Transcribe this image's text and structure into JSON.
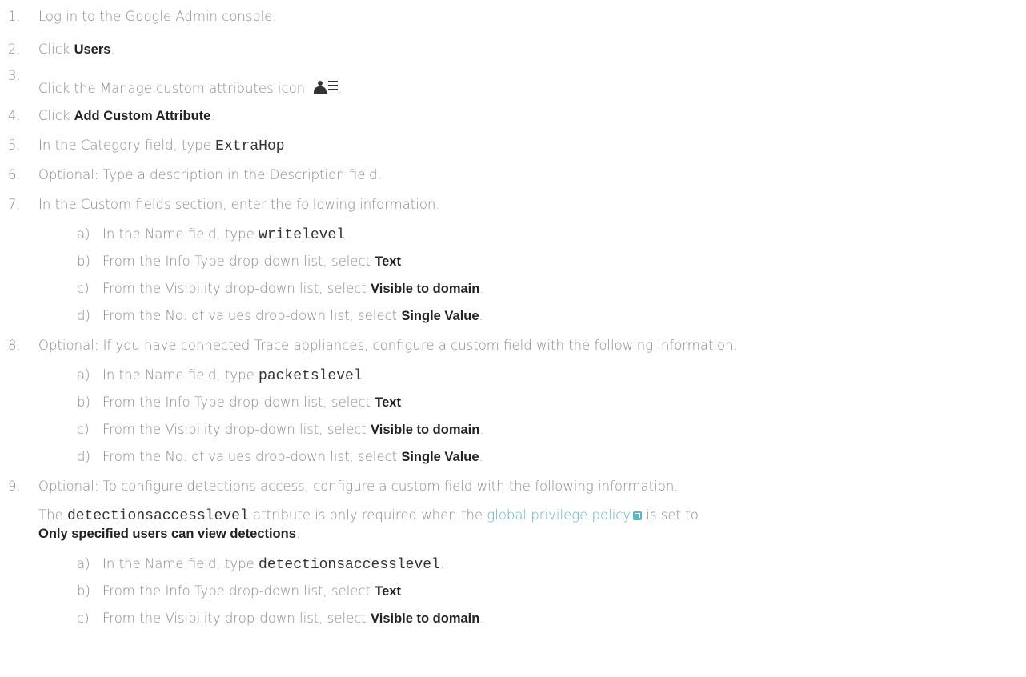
{
  "steps": [
    {
      "num": "1.",
      "t1": "Log in to the Google Admin console."
    },
    {
      "num": "2.",
      "t1": "Click ",
      "b1": "Users",
      "t2": "."
    },
    {
      "num": "3.",
      "t1": "Click the Manage custom attributes icon ",
      "t2": ".",
      "icon": "manage-custom-attributes-icon"
    },
    {
      "num": "4.",
      "t1": "Click ",
      "b1": "Add Custom Attribute",
      "t2": "."
    },
    {
      "num": "5.",
      "t1": "In the Category field, type ",
      "c1": "ExtraHop",
      "t2": "."
    },
    {
      "num": "6.",
      "t1": "Optional: Type a description in the Description field."
    },
    {
      "num": "7.",
      "t1": "In the Custom fields section, enter the following information."
    },
    {
      "num": "8.",
      "t1": "Optional: If you have connected Trace appliances, configure a custom field with the following information."
    },
    {
      "num": "9.",
      "t1": "Optional: To configure detections access, configure a custom field with the following information."
    }
  ],
  "substeps_7": [
    {
      "num": "a)",
      "t1": "In the Name field, type ",
      "c1": "writelevel",
      "t2": "."
    },
    {
      "num": "b)",
      "t1": "From the Info Type drop-down list, select ",
      "b1": "Text",
      "t2": "."
    },
    {
      "num": "c)",
      "t1": "From the Visibility drop-down list, select ",
      "b1": "Visible to domain",
      "t2": "."
    },
    {
      "num": "d)",
      "t1": "From the No. of values drop-down list, select ",
      "b1": "Single Value",
      "t2": "."
    }
  ],
  "substeps_8": [
    {
      "num": "a)",
      "t1": "In the Name field, type ",
      "c1": "packetslevel",
      "t2": "."
    },
    {
      "num": "b)",
      "t1": "From the Info Type drop-down list, select ",
      "b1": "Text",
      "t2": "."
    },
    {
      "num": "c)",
      "t1": "From the Visibility drop-down list, select ",
      "b1": "Visible to domain",
      "t2": "."
    },
    {
      "num": "d)",
      "t1": "From the No. of values drop-down list, select ",
      "b1": "Single Value",
      "t2": "."
    }
  ],
  "note_9": {
    "t1": "The ",
    "c1": "detectionsaccesslevel",
    "t2": " attribute is only required when the ",
    "link": "global privilege policy",
    "link_icon": "external-link-icon",
    "t3": " is set to",
    "b1": "Only specified users can view detections",
    "t4": "."
  },
  "substeps_9": [
    {
      "num": "a)",
      "t1": "In the Name field, type ",
      "c1": "detectionsaccesslevel",
      "t2": "."
    },
    {
      "num": "b)",
      "t1": "From the Info Type drop-down list, select ",
      "b1": "Text",
      "t2": "."
    },
    {
      "num": "c)",
      "t1": "From the Visibility drop-down list, select ",
      "b1": "Visible to domain",
      "t2": "."
    }
  ],
  "colors": {
    "text": "#8a8a8a",
    "bold": "#222222",
    "link": "#5bb4c8"
  }
}
